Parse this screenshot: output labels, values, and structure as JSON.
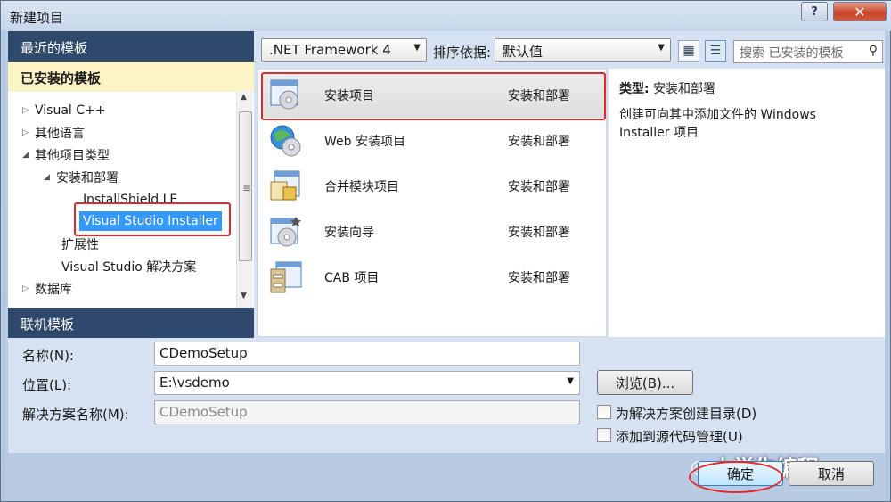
{
  "window": {
    "title": "新建项目",
    "help_label": "?",
    "close_label": "✕"
  },
  "left_panel": {
    "recent_header": "最近的模板",
    "installed_header": "已安装的模板",
    "online_header": "联机模板",
    "tree": [
      {
        "label": "Visual C++",
        "arrow": "▷"
      },
      {
        "label": "其他语言",
        "arrow": "▷"
      },
      {
        "label": "其他项目类型",
        "arrow": "◢"
      },
      {
        "label": "安装和部署",
        "arrow": "◢"
      },
      {
        "label": "InstallShield LE",
        "arrow": ""
      },
      {
        "label": "Visual Studio Installer",
        "arrow": ""
      },
      {
        "label": "扩展性",
        "arrow": ""
      },
      {
        "label": "Visual Studio 解决方案",
        "arrow": ""
      },
      {
        "label": "数据库",
        "arrow": "▷"
      }
    ]
  },
  "toolbar": {
    "framework": ".NET Framework 4",
    "sort_label": "排序依据:",
    "sort_value": "默认值",
    "search_placeholder": "搜索 已安装的模板"
  },
  "templates": [
    {
      "name": "安装项目",
      "category": "安装和部署",
      "icon": "setup-project-icon"
    },
    {
      "name": "Web 安装项目",
      "category": "安装和部署",
      "icon": "web-setup-icon"
    },
    {
      "name": "合并模块项目",
      "category": "安装和部署",
      "icon": "merge-module-icon"
    },
    {
      "name": "安装向导",
      "category": "安装和部署",
      "icon": "setup-wizard-icon"
    },
    {
      "name": "CAB 项目",
      "category": "安装和部署",
      "icon": "cab-project-icon"
    }
  ],
  "description": {
    "type_label": "类型:",
    "type_value": "安装和部署",
    "text": "创建可向其中添加文件的 Windows Installer 项目"
  },
  "form": {
    "name_label": "名称(N):",
    "name_value": "CDemoSetup",
    "location_label": "位置(L):",
    "location_value": "E:\\vsdemo",
    "solution_label": "解决方案名称(M):",
    "solution_value": "CDemoSetup",
    "browse_label": "浏览(B)...",
    "create_dir_label": "为解决方案创建目录(D)",
    "add_source_label": "添加到源代码管理(U)",
    "ok_label": "确定",
    "cancel_label": "取消"
  },
  "watermark": "小学生编程"
}
